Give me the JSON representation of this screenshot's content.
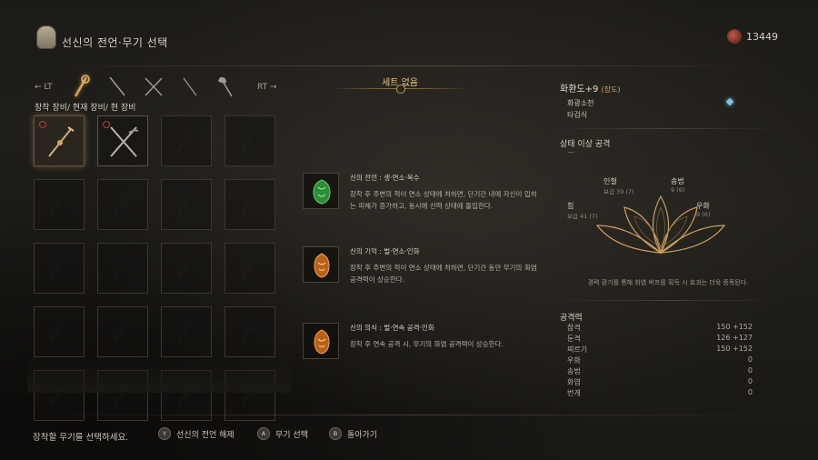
{
  "header": {
    "title": "선신의 전언·무기 선택",
    "currency": "13449"
  },
  "tabs": {
    "left_hint": "← LT",
    "right_hint": "RT →",
    "items": [
      "staff-icon",
      "spear-icon",
      "crossed-swords-icon",
      "blade-icon",
      "axe-icon"
    ]
  },
  "equip_label": "장착 장비/ 현재 장비/ 현 장비",
  "set_bonus": "세트 없음",
  "relics": [
    {
      "name": "신의 전언 : 생·연소·복수",
      "desc": "장착 후 주변의 적이 연소 상태에 처하면, 단기간 내에 자신이 입히는 피해가 증가하고, 동시에 신력 상태에 돌입한다.",
      "color": "#3fa94a"
    },
    {
      "name": "신의 기억 : 벌·연소·인화",
      "desc": "장착 후 주변의 적이 연소 상태에 처하면, 단기간 동안 무기의 화염 공격력이 상승한다.",
      "color": "#d9822b"
    },
    {
      "name": "신의 의식 : 벌·연속 공격·인화",
      "desc": "장착 후 연속 공격 시, 무기의 화염 공격력이 상승한다.",
      "color": "#d9822b"
    }
  ],
  "weapon": {
    "name": "화환도+9",
    "slot_type": "(장도)",
    "skills": [
      "화광소천",
      "타검식"
    ]
  },
  "status_effect": {
    "title": "상태 이상 공격",
    "value": "—"
  },
  "attributes": [
    {
      "label": "인철",
      "value": "보급 39 (7)"
    },
    {
      "label": "송법",
      "value": "9 (6)"
    },
    {
      "label": "힘",
      "value": "보급 41 (7)"
    },
    {
      "label": "우화",
      "value": "9 (6)"
    }
  ],
  "attr_hint": "경력 환기를 통해 화염 버프를 획득 시 효과는 더욱 증폭된다.",
  "attack": {
    "title": "공격력",
    "rows": [
      {
        "label": "참격",
        "value": "150 +152"
      },
      {
        "label": "둔격",
        "value": "126 +127"
      },
      {
        "label": "찌르기",
        "value": "150 +152"
      },
      {
        "label": "우화",
        "value": "0"
      },
      {
        "label": "송법",
        "value": "0"
      },
      {
        "label": "화염",
        "value": "0"
      },
      {
        "label": "번개",
        "value": "0"
      }
    ]
  },
  "footer": {
    "prompt": "장착할 무기를 선택하세요.",
    "buttons": [
      {
        "key": "Y",
        "label": "선신의 전언 해제"
      },
      {
        "key": "A",
        "label": "무기 선택"
      },
      {
        "key": "B",
        "label": "돌아가기"
      }
    ]
  },
  "colors": {
    "accent": "#c8a060",
    "relic_green": "#3fa94a",
    "relic_orange": "#d9822b",
    "gem": "#7fc3e8"
  }
}
